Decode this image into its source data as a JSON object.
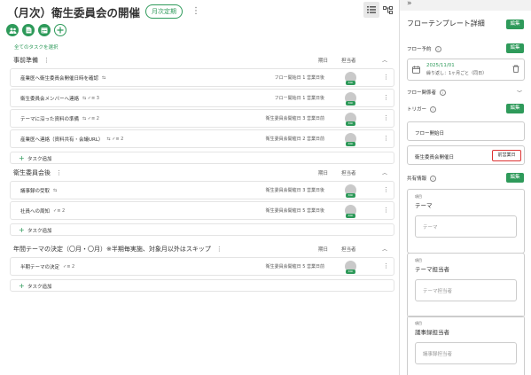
{
  "header": {
    "title": "（月次）衛生委員会の開催",
    "badge": "月次定期",
    "kebab": "⋮"
  },
  "toolbar": {
    "select_all": "全てのタスクを選択"
  },
  "colors": {
    "accent": "#2e9a5a",
    "highlight": "#dd3333"
  },
  "sections": [
    {
      "title": "事前準備",
      "col_due": "期日",
      "col_assignee": "担当者",
      "tasks": [
        {
          "name": "産業医へ衛生委員会開催日時を確認",
          "icons": "⇆",
          "due": "フロー開始日 1 営業日後"
        },
        {
          "name": "衛生委員会メンバーへ連絡",
          "icons": "⇆ ✓≡ 3",
          "due": "フロー開始日 1 営業日後"
        },
        {
          "name": "テーマに沿った資料の準備",
          "icons": "⇆ ✓≡ 2",
          "due": "衛生委員会開催日 3 営業日前"
        },
        {
          "name": "産業医へ連絡（資料共有・会議URL）",
          "icons": "⇆ ✓≡ 2",
          "due": "衛生委員会開催日 2 営業日前"
        }
      ],
      "add_label": "タスク追加"
    },
    {
      "title": "衛生委員会後",
      "col_due": "期日",
      "col_assignee": "担当者",
      "tasks": [
        {
          "name": "議事録の受取",
          "icons": "⇆",
          "due": "衛生委員会開催日 3 営業日後"
        },
        {
          "name": "社員への周知",
          "icons": "✓≡ 2",
          "due": "衛生委員会開催日 5 営業日後"
        }
      ],
      "add_label": "タスク追加"
    },
    {
      "title": "年間テーマの決定（〇月・〇月）※半期毎実施、対象月以外はスキップ",
      "col_due": "期日",
      "col_assignee": "担当者",
      "tasks": [
        {
          "name": "半期テーマの決定",
          "icons": "✓≡ 2",
          "due": "衛生委員会開催日 5 営業日前"
        }
      ],
      "add_label": "タスク追加"
    }
  ],
  "avatar_tag": "Kiki",
  "right_panel": {
    "collapse": "»",
    "title": "フローテンプレート詳細",
    "edit_label": "編集",
    "schedule": {
      "label": "フロー予約",
      "date": "2025/11/01",
      "repeat": "繰り返し：1ヶ月ごと（同日）"
    },
    "related": {
      "label": "フロー関係者"
    },
    "trigger": {
      "label": "トリガー",
      "item1": "フロー開始日",
      "item2": "衛生委員会開催日",
      "prev_day": "前営業日"
    },
    "shared": {
      "label": "共有情報",
      "fields": [
        {
          "small": "項目",
          "name": "テーマ",
          "placeholder": "テーマ"
        },
        {
          "small": "項目",
          "name": "テーマ担当者",
          "placeholder": "テーマ担当者"
        },
        {
          "small": "項目",
          "name": "議事録担当者",
          "placeholder": "議事録担当者"
        }
      ]
    }
  }
}
